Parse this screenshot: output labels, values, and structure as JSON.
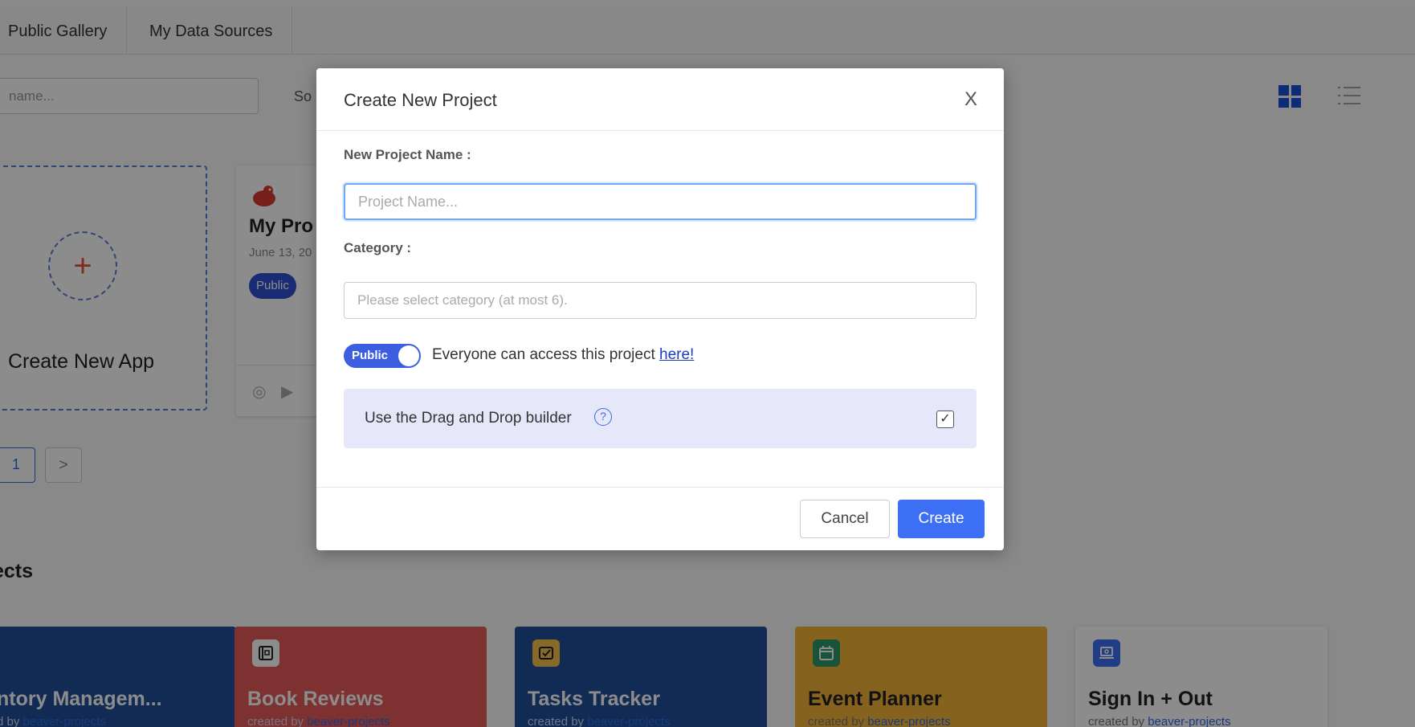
{
  "tabs": [
    {
      "label": "Public Gallery"
    },
    {
      "label": "My Data Sources"
    }
  ],
  "toolbar": {
    "search_placeholder": "name...",
    "sort_label": "So",
    "view_grid_icon": "grid-view-icon",
    "view_list_icon": "list-view-icon"
  },
  "create_app": {
    "label": "Create New App",
    "icon": "plus-icon"
  },
  "project_card": {
    "title": "My Pro",
    "date": "June 13, 20",
    "badge": "Public"
  },
  "pagination": {
    "current": "1",
    "next": ">"
  },
  "section": {
    "title": "jects"
  },
  "templates": [
    {
      "title": "ntory Managem...",
      "by_prefix": "d by",
      "by_link": "beaver-projects",
      "bg": "#1f4f9c",
      "text": "#ffffff",
      "icon": "inventory-icon"
    },
    {
      "title": "Book Reviews",
      "by_prefix": "created by",
      "by_link": "beaver-projects",
      "bg": "#e35a5a",
      "text": "#ffffff",
      "icon": "book-icon"
    },
    {
      "title": "Tasks Tracker",
      "by_prefix": "created by",
      "by_link": "beaver-projects",
      "bg": "#1f4f9c",
      "text": "#ffffff",
      "icon": "task-icon"
    },
    {
      "title": "Event Planner",
      "by_prefix": "created by",
      "by_link": "beaver-projects",
      "bg": "#f2b43a",
      "text": "#222222",
      "icon": "calendar-icon"
    },
    {
      "title": "Sign In + Out",
      "by_prefix": "created by",
      "by_link": "beaver-projects",
      "bg": "#ffffff",
      "text": "#222222",
      "icon": "laptop-icon"
    }
  ],
  "modal": {
    "title": "Create New Project",
    "close_label": "X",
    "name_label": "New Project Name :",
    "name_placeholder": "Project Name...",
    "category_label": "Category :",
    "category_placeholder": "Please select category (at most 6).",
    "toggle_label": "Public",
    "access_text": "Everyone can access this project ",
    "access_link": "here!",
    "dnd_text": "Use the Drag and Drop builder",
    "dnd_help": "?",
    "dnd_checked": true,
    "cancel_label": "Cancel",
    "create_label": "Create"
  },
  "colors": {
    "accent": "#3d6ff5",
    "toggle": "#3d5ee1",
    "dnd_bg": "#e6e8fa"
  }
}
